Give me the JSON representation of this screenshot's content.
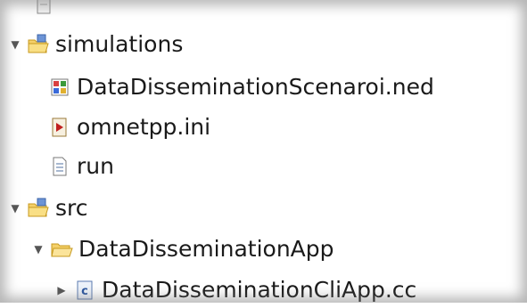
{
  "tree": {
    "items": [
      {
        "label": "simulations",
        "icon": "project-folder-icon",
        "expanded": true
      },
      {
        "label": "DataDisseminationScenaroi.ned",
        "icon": "ned-file-icon"
      },
      {
        "label": "omnetpp.ini",
        "icon": "ini-file-icon"
      },
      {
        "label": "run",
        "icon": "text-file-icon"
      },
      {
        "label": "src",
        "icon": "project-folder-icon",
        "expanded": true
      },
      {
        "label": "DataDisseminationApp",
        "icon": "folder-icon",
        "expanded": true
      },
      {
        "label": "DataDisseminationCliApp.cc",
        "icon": "cpp-file-icon",
        "expanded": false
      }
    ]
  }
}
